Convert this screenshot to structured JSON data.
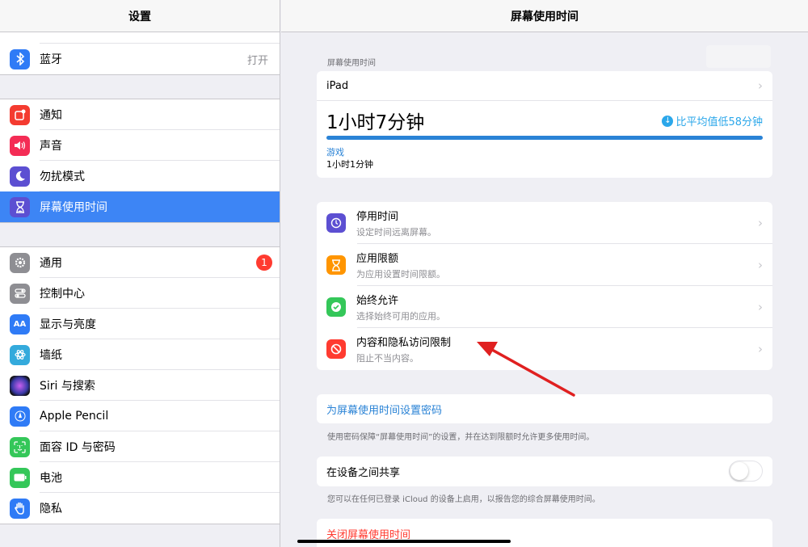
{
  "sidebar": {
    "title": "设置",
    "group1": [
      {
        "label": "蓝牙",
        "value": "打开",
        "icon": "bluetooth-icon",
        "color": "#2f7bf6"
      }
    ],
    "group2": [
      {
        "label": "通知",
        "icon": "notifications-icon",
        "color": "#f43b30"
      },
      {
        "label": "声音",
        "icon": "sounds-icon",
        "color": "#f42c55"
      },
      {
        "label": "勿扰模式",
        "icon": "do-not-disturb-icon",
        "color": "#5c4fd2"
      },
      {
        "label": "屏幕使用时间",
        "icon": "screen-time-icon",
        "color": "#5c4fd2",
        "active": true
      }
    ],
    "group3": [
      {
        "label": "通用",
        "icon": "gear-icon",
        "color": "#8e8e93",
        "badge": "1"
      },
      {
        "label": "控制中心",
        "icon": "control-center-icon",
        "color": "#8e8e93"
      },
      {
        "label": "显示与亮度",
        "icon": "display-brightness-icon",
        "color": "#2f7bf6"
      },
      {
        "label": "墙纸",
        "icon": "wallpaper-icon",
        "color": "#34aadc"
      },
      {
        "label": "Siri 与搜索",
        "icon": "siri-icon",
        "color": "#222"
      },
      {
        "label": "Apple Pencil",
        "icon": "pencil-icon",
        "color": "#2f7bf6"
      },
      {
        "label": "面容 ID 与密码",
        "icon": "face-id-icon",
        "color": "#34c759"
      },
      {
        "label": "电池",
        "icon": "battery-icon",
        "color": "#34c759"
      },
      {
        "label": "隐私",
        "icon": "privacy-hand-icon",
        "color": "#2f7bf6"
      }
    ]
  },
  "detail": {
    "title": "屏幕使用时间",
    "usage_caption": "屏幕使用时间",
    "device": "iPad",
    "total_time": "1小时7分钟",
    "compare_text": "比平均值低58分钟",
    "category_name": "游戏",
    "category_time": "1小时1分钟",
    "options": [
      {
        "title": "停用时间",
        "subtitle": "设定时间远离屏幕。",
        "icon": "downtime-icon",
        "color": "#5c4fd2"
      },
      {
        "title": "应用限额",
        "subtitle": "为应用设置时间限额。",
        "icon": "app-limits-icon",
        "color": "#ff9500"
      },
      {
        "title": "始终允许",
        "subtitle": "选择始终可用的应用。",
        "icon": "always-allowed-icon",
        "color": "#34c759"
      },
      {
        "title": "内容和隐私访问限制",
        "subtitle": "阻止不当内容。",
        "icon": "restrictions-icon",
        "color": "#ff3b30"
      }
    ],
    "passcode_link": "为屏幕使用时间设置密码",
    "passcode_note": "使用密码保障“屏幕使用时间”的设置，并在达到限额时允许更多使用时间。",
    "share_label": "在设备之间共享",
    "share_enabled": false,
    "share_note": "您可以在任何已登录 iCloud 的设备上启用，以报告您的综合屏幕使用时间。",
    "turn_off": "关闭屏幕使用时间"
  },
  "colors": {
    "accent": "#2a83d6",
    "active_row": "#3d85f5",
    "danger": "#ff3b30",
    "annotation_arrow": "#e02020"
  }
}
